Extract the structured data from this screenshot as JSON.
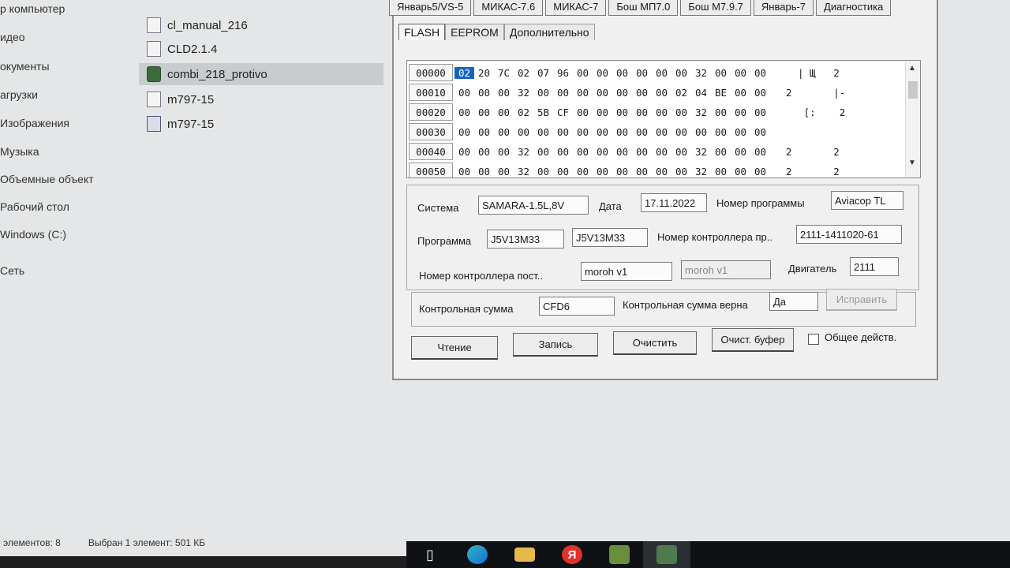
{
  "explorer": {
    "nav_items": [
      "р компьютер",
      "идео",
      "окументы",
      "агрузки",
      "Изображения",
      "Музыка",
      "Объемные объект",
      "Рабочий стол",
      "Windows (C:)",
      "Сеть"
    ],
    "files": [
      {
        "name": "cl_manual_216",
        "icon": "file-icon"
      },
      {
        "name": "CLD2.1.4",
        "icon": "file-icon"
      },
      {
        "name": "combi_218_protivo",
        "icon": "executable-icon"
      },
      {
        "name": "m797-15",
        "icon": "file-icon"
      },
      {
        "name": "m797-15",
        "icon": "binary-file-icon"
      }
    ],
    "status": {
      "count": "элементов: 8",
      "selected": "Выбран 1 элемент: 501 КБ"
    }
  },
  "dialog": {
    "top_tabs": [
      "Январь5/VS-5",
      "МИКАС-7.6",
      "МИКАС-7",
      "Бош МП7.0",
      "Бош М7.9.7",
      "Январь-7",
      "Диагностика"
    ],
    "sub_tabs": [
      "FLASH",
      "EEPROM",
      "Дополнительно"
    ],
    "hex": {
      "rows": [
        {
          "addr": "00000",
          "bytes": [
            "02",
            "20",
            "7C",
            "02",
            "07",
            "96",
            "00",
            "00",
            "00",
            "00",
            "00",
            "00",
            "32",
            "00",
            "00",
            "00"
          ],
          "ascii": "  | Щ   2"
        },
        {
          "addr": "00010",
          "bytes": [
            "00",
            "00",
            "00",
            "32",
            "00",
            "00",
            "00",
            "00",
            "00",
            "00",
            "00",
            "02",
            "04",
            "BE",
            "00",
            "00"
          ],
          "ascii": "2       |-"
        },
        {
          "addr": "00020",
          "bytes": [
            "00",
            "00",
            "00",
            "02",
            "5B",
            "CF",
            "00",
            "00",
            "00",
            "00",
            "00",
            "00",
            "32",
            "00",
            "00",
            "00"
          ],
          "ascii": "   [:    2"
        },
        {
          "addr": "00030",
          "bytes": [
            "00",
            "00",
            "00",
            "00",
            "00",
            "00",
            "00",
            "00",
            "00",
            "00",
            "00",
            "00",
            "00",
            "00",
            "00",
            "00"
          ],
          "ascii": ""
        },
        {
          "addr": "00040",
          "bytes": [
            "00",
            "00",
            "00",
            "32",
            "00",
            "00",
            "00",
            "00",
            "00",
            "00",
            "00",
            "00",
            "32",
            "00",
            "00",
            "00"
          ],
          "ascii": "2       2"
        },
        {
          "addr": "00050",
          "bytes": [
            "00",
            "00",
            "00",
            "32",
            "00",
            "00",
            "00",
            "00",
            "00",
            "00",
            "00",
            "00",
            "32",
            "00",
            "00",
            "00"
          ],
          "ascii": "2       2"
        }
      ]
    },
    "info": {
      "system_label": "Система",
      "system_value": "SAMARA-1.5L,8V",
      "date_label": "Дата",
      "date_value": "17.11.2022",
      "prog_no_label": "Номер программы",
      "prog_no_value": "Aviacop TL",
      "program_label": "Программа",
      "program_value1": "J5V13M33",
      "program_value2": "J5V13M33",
      "ctrl_no_label": "Номер контроллера пр..",
      "ctrl_no_value": "2111-1411020-61",
      "ctrl_post_label": "Номер контроллера пост..",
      "ctrl_post_value1": "moroh v1",
      "ctrl_post_value2": "moroh v1",
      "engine_label": "Двигатель",
      "engine_value": "2111"
    },
    "checksum": {
      "label": "Контрольная сумма",
      "value": "CFD6",
      "valid_label": "Контрольная сумма верна",
      "valid_value": "Да",
      "fix_button": "Исправить"
    },
    "buttons": {
      "read": "Чтение",
      "write": "Запись",
      "clear": "Очистить",
      "clear_buffer": "Очист. буфер",
      "common_action": "Общее действ."
    }
  },
  "taskbar": {
    "apps": [
      "task-view-icon",
      "edge-icon",
      "file-explorer-icon",
      "yandex-browser-icon",
      "app-icon",
      "combiloader-icon"
    ],
    "yandex_letter": "Я"
  }
}
